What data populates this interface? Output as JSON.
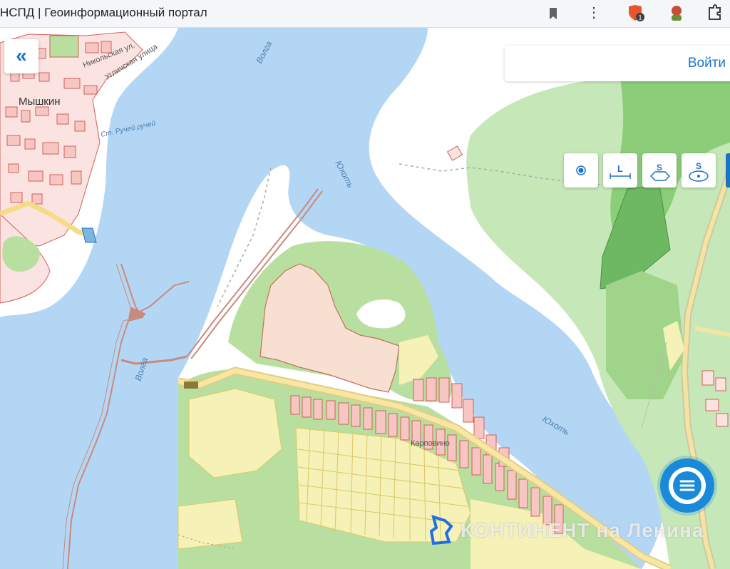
{
  "browser": {
    "tab_title": "НСПД | Геоинформационный портал"
  },
  "map": {
    "labels": {
      "town_myshkin": "Мышкин",
      "river_volga_top": "Волга",
      "river_volga_bottom": "Волга",
      "river_yukhot_top": "Юхоть",
      "river_yukhot_bottom": "Юхоть",
      "stream": "Ст. Ручей ручей",
      "street_nikolskaya": "Никольская ул.",
      "street_uglichskaya": "Угличская улица",
      "village": "Карповино"
    }
  },
  "ui": {
    "collapse_label": "«",
    "login_label": "Войти",
    "tools": [
      {
        "name": "point",
        "icon": "point-measure-icon"
      },
      {
        "name": "length",
        "icon": "length-measure-icon",
        "glyph": "L"
      },
      {
        "name": "area",
        "icon": "area-measure-icon",
        "glyph": "S"
      },
      {
        "name": "circle-area",
        "icon": "circle-area-measure-icon",
        "glyph": "S"
      }
    ]
  },
  "watermark": "КОНТИНЕНТ на Ленина",
  "colors": {
    "water": "#b4d6f5",
    "land": "#ffffff",
    "forest": "#c6e8b8",
    "forest_dark": "#7cc26e",
    "residential": "#fbe3e1",
    "parcel_border": "#d0605a",
    "field": "#f6f1b6",
    "road": "#f8e7a4",
    "accent": "#1a73c8"
  }
}
